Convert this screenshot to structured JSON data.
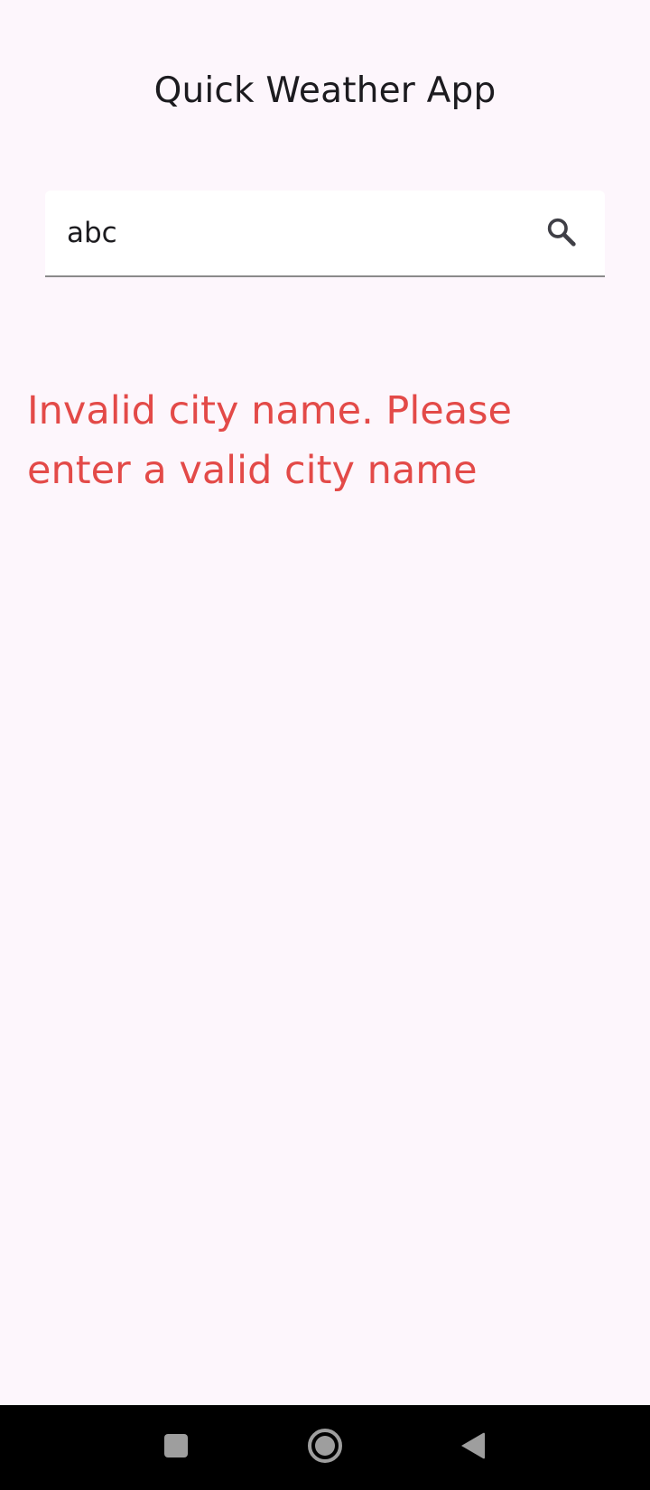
{
  "app": {
    "title": "Quick Weather App"
  },
  "search": {
    "value": "abc",
    "icon": "search-icon"
  },
  "error": {
    "message": "Invalid city name. Please enter a valid city name",
    "color": "#e34a48"
  },
  "navbar": {
    "recents_icon": "square-icon",
    "home_icon": "circle-icon",
    "back_icon": "triangle-back-icon"
  },
  "colors": {
    "background": "#fdf6fc",
    "accent": "#6750a4",
    "error": "#e34a48"
  }
}
